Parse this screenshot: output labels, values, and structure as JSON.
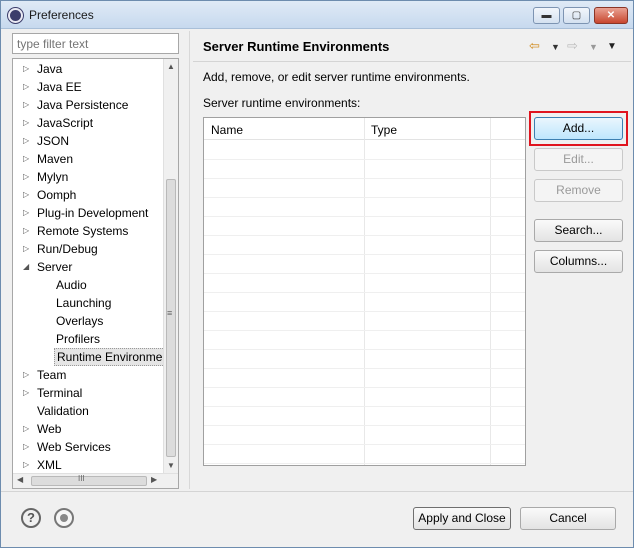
{
  "window": {
    "title": "Preferences",
    "controls": {
      "minimize": "▬",
      "maximize": "▢",
      "close": "✕"
    }
  },
  "filter": {
    "placeholder": "type filter text"
  },
  "tree": {
    "items": [
      {
        "label": "Java",
        "arrow": "▷",
        "level": 0
      },
      {
        "label": "Java EE",
        "arrow": "▷",
        "level": 0
      },
      {
        "label": "Java Persistence",
        "arrow": "▷",
        "level": 0
      },
      {
        "label": "JavaScript",
        "arrow": "▷",
        "level": 0
      },
      {
        "label": "JSON",
        "arrow": "▷",
        "level": 0
      },
      {
        "label": "Maven",
        "arrow": "▷",
        "level": 0
      },
      {
        "label": "Mylyn",
        "arrow": "▷",
        "level": 0
      },
      {
        "label": "Oomph",
        "arrow": "▷",
        "level": 0
      },
      {
        "label": "Plug-in Development",
        "arrow": "▷",
        "level": 0
      },
      {
        "label": "Remote Systems",
        "arrow": "▷",
        "level": 0
      },
      {
        "label": "Run/Debug",
        "arrow": "▷",
        "level": 0
      },
      {
        "label": "Server",
        "arrow": "◢",
        "level": 0
      },
      {
        "label": "Audio",
        "arrow": "",
        "level": 1
      },
      {
        "label": "Launching",
        "arrow": "",
        "level": 1
      },
      {
        "label": "Overlays",
        "arrow": "",
        "level": 1
      },
      {
        "label": "Profilers",
        "arrow": "",
        "level": 1
      },
      {
        "label": "Runtime Environme",
        "arrow": "",
        "level": 1,
        "selected": true
      },
      {
        "label": "Team",
        "arrow": "▷",
        "level": 0
      },
      {
        "label": "Terminal",
        "arrow": "▷",
        "level": 0
      },
      {
        "label": "Validation",
        "arrow": "",
        "level": 0
      },
      {
        "label": "Web",
        "arrow": "▷",
        "level": 0
      },
      {
        "label": "Web Services",
        "arrow": "▷",
        "level": 0
      },
      {
        "label": "XML",
        "arrow": "▷",
        "level": 0
      }
    ],
    "scroll": {
      "up": "▲",
      "down": "▼",
      "left": "◀",
      "right": "▶",
      "thumb_grip": "≡",
      "hthumb_grip": "III"
    }
  },
  "page": {
    "title": "Server Runtime Environments",
    "nav": {
      "back": "⇦",
      "back_menu": "▼",
      "forward": "⇨",
      "forward_menu": "▼",
      "menu": "▼"
    },
    "description": "Add, remove, or edit server runtime environments.",
    "list_label": "Server runtime environments:",
    "table": {
      "columns": [
        "Name",
        "Type"
      ],
      "rows": []
    },
    "buttons": {
      "add": "Add...",
      "edit": "Edit...",
      "remove": "Remove",
      "search": "Search...",
      "columns": "Columns..."
    }
  },
  "footer": {
    "help_icon": "?",
    "apply_close": "Apply and Close",
    "cancel": "Cancel"
  },
  "colors": {
    "highlight": "#e0141e",
    "title_bar": "#c7d9ee",
    "close_button": "#c8462f"
  }
}
